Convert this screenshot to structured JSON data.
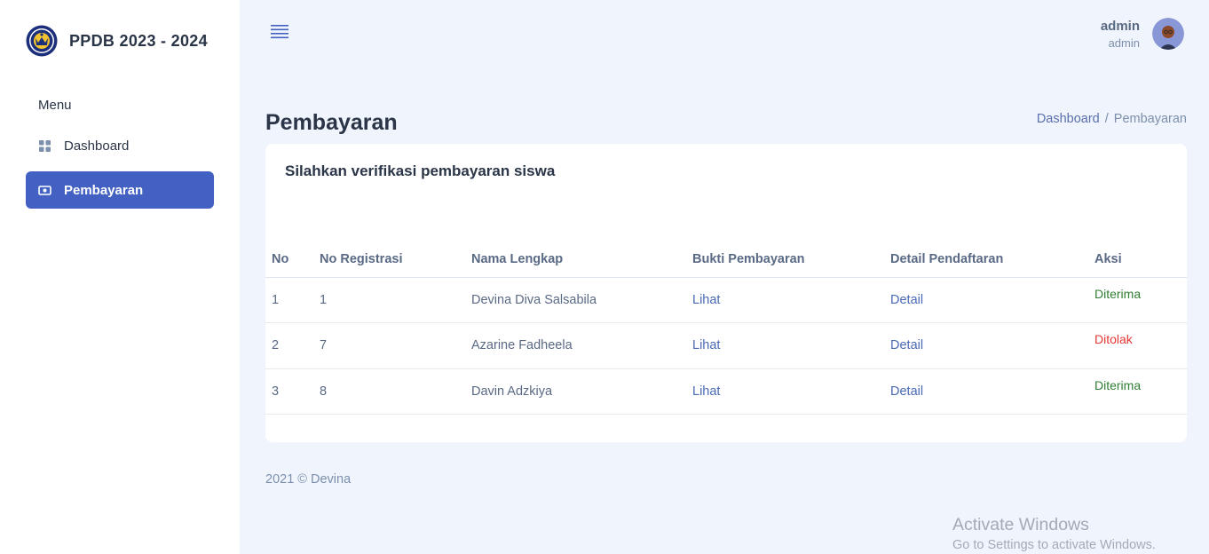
{
  "brand": {
    "name": "PPDB 2023 - 2024"
  },
  "sidebar": {
    "menu_title": "Menu",
    "items": [
      {
        "label": "Dashboard",
        "icon": "dashboard-grid-icon",
        "active": false
      },
      {
        "label": "Pembayaran",
        "icon": "cash-icon",
        "active": true
      }
    ]
  },
  "header": {
    "user_name": "admin",
    "user_role": "admin"
  },
  "page": {
    "title": "Pembayaran",
    "breadcrumb": {
      "home": "Dashboard",
      "separator": "/",
      "current": "Pembayaran"
    }
  },
  "card": {
    "title": "Silahkan verifikasi pembayaran siswa",
    "table": {
      "columns": [
        "No",
        "No Registrasi",
        "Nama Lengkap",
        "Bukti Pembayaran",
        "Detail Pendaftaran",
        "Aksi"
      ],
      "rows": [
        {
          "no": "1",
          "reg": "1",
          "name": "Devina Diva Salsabila",
          "bukti": "Lihat",
          "detail": "Detail",
          "status": "Diterima",
          "status_color": "#2e7d32"
        },
        {
          "no": "2",
          "reg": "7",
          "name": "Azarine Fadheela",
          "bukti": "Lihat",
          "detail": "Detail",
          "status": "Ditolak",
          "status_color": "#e53935"
        },
        {
          "no": "3",
          "reg": "8",
          "name": "Davin Adzkiya",
          "bukti": "Lihat",
          "detail": "Detail",
          "status": "Diterima",
          "status_color": "#2e7d32"
        }
      ]
    }
  },
  "footer": {
    "text": "2021 © Devina"
  },
  "watermark": {
    "line1": "Activate Windows",
    "line2": "Go to Settings to activate Windows."
  },
  "colors": {
    "accent": "#4361c2",
    "background": "#f0f4fc"
  }
}
